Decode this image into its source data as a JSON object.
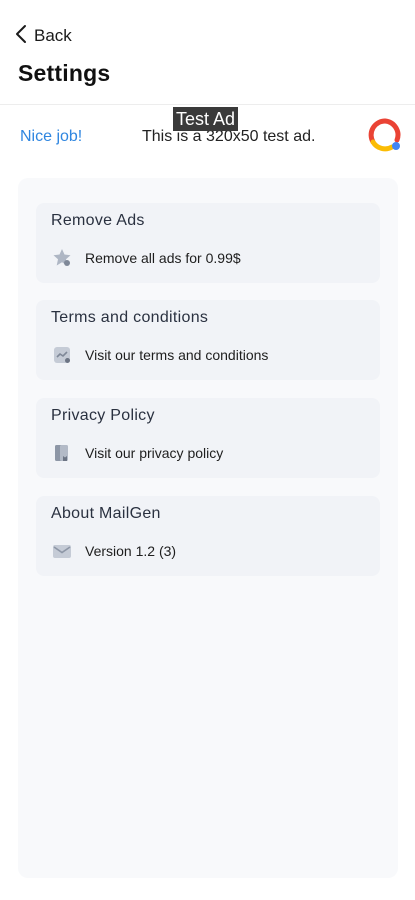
{
  "header": {
    "back_label": "Back",
    "title": "Settings"
  },
  "ad": {
    "tag": "Test Ad",
    "left_text": "Nice job!",
    "main_text": "This is a 320x50 test ad.",
    "logo_icon": "admob-logo-icon"
  },
  "settings": {
    "items": [
      {
        "title": "Remove Ads",
        "text": "Remove all ads for 0.99$",
        "icon": "star-badge-icon"
      },
      {
        "title": "Terms and conditions",
        "text": "Visit our terms and conditions",
        "icon": "document-icon"
      },
      {
        "title": "Privacy Policy",
        "text": "Visit our privacy policy",
        "icon": "book-icon"
      },
      {
        "title": "About MailGen",
        "text": "Version 1.2 (3)",
        "icon": "mail-icon"
      }
    ]
  },
  "colors": {
    "link": "#2f86e0",
    "card_bg": "#f1f3f7",
    "panel_bg": "#f8f9fb"
  }
}
